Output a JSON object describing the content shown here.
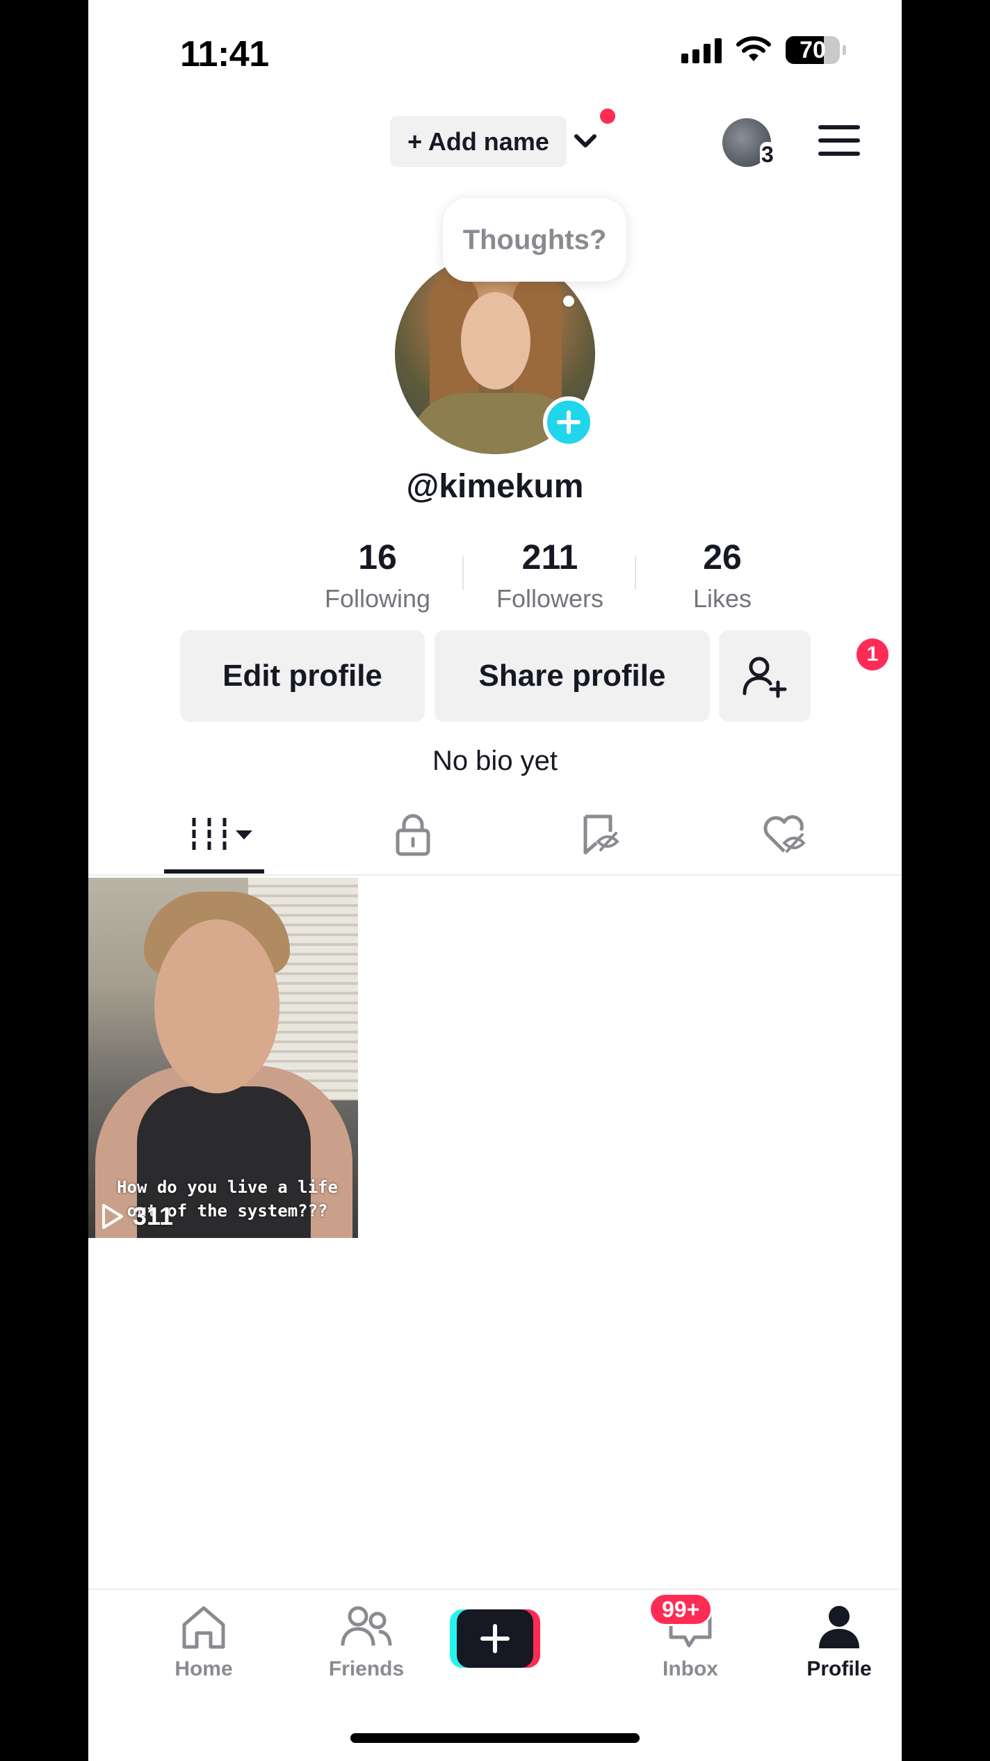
{
  "status_bar": {
    "time": "11:41",
    "battery": "70",
    "battery_level": 0.7
  },
  "header": {
    "add_name_label": "+ Add name",
    "account_count": "3"
  },
  "profile": {
    "bubble_text": "Thoughts?",
    "username": "@kimekum",
    "bio": "No bio yet"
  },
  "stats": [
    {
      "value": "16",
      "label": "Following"
    },
    {
      "value": "211",
      "label": "Followers"
    },
    {
      "value": "26",
      "label": "Likes"
    }
  ],
  "actions": {
    "edit_label": "Edit profile",
    "share_label": "Share profile",
    "friend_badge": "1"
  },
  "tabs": [
    "videos-grid",
    "private",
    "favorites-hidden",
    "liked-hidden"
  ],
  "videos": [
    {
      "views": "311",
      "caption": "How do you live a life out of the system???"
    }
  ],
  "nav": {
    "home": "Home",
    "friends": "Friends",
    "inbox": "Inbox",
    "inbox_badge": "99+",
    "profile": "Profile"
  },
  "colors": {
    "accent": "#fe2c55",
    "cyan": "#20d5ec",
    "text": "#161823",
    "muted": "#8a8b91"
  }
}
